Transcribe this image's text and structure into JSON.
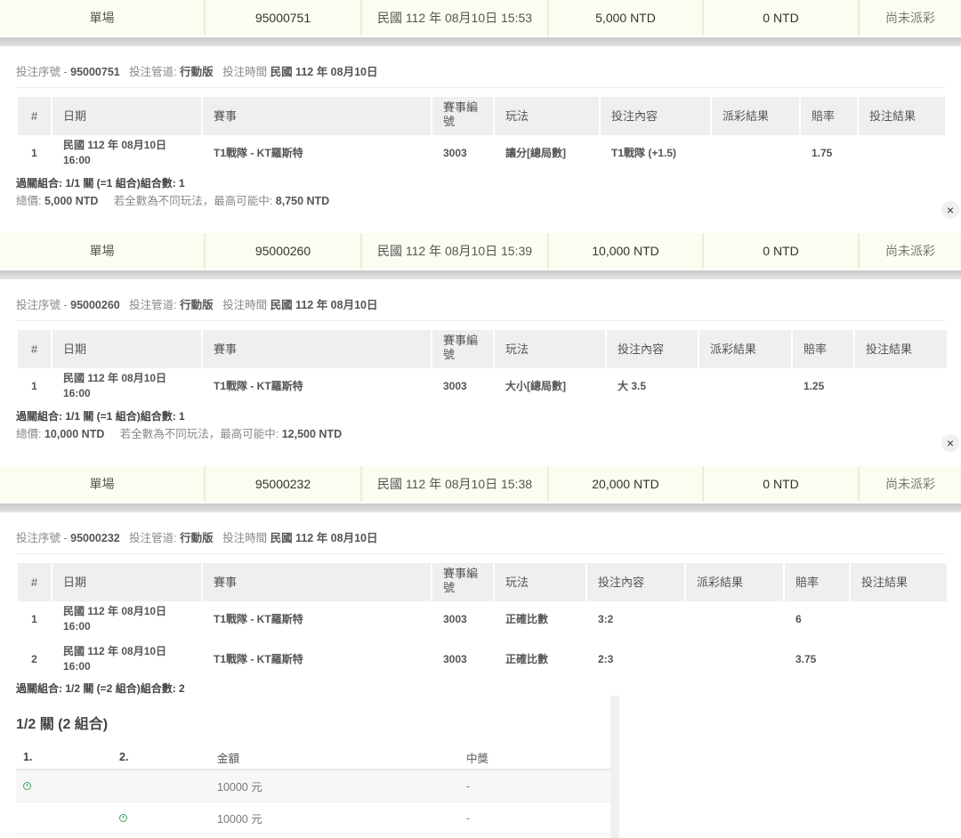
{
  "bets": [
    {
      "summary": {
        "type": "單場",
        "id": "95000751",
        "time": "民國 112 年 08月10日 15:53",
        "stake": "5,000 NTD",
        "payout": "0 NTD",
        "status": "尚未派彩"
      },
      "detail": {
        "serial_label": "投注序號 -",
        "serial": "95000751",
        "channel_label": "投注管道:",
        "channel": "行動版",
        "time_label": "投注時間",
        "time": "民國 112 年 08月10日",
        "headers": [
          "#",
          "日期",
          "賽事",
          "賽事編號",
          "玩法",
          "投注內容",
          "派彩結果",
          "賠率",
          "投注結果"
        ],
        "rows": [
          {
            "no": "1",
            "date": "民國 112 年 08月10日 16:00",
            "match": "T1戰隊 - KT羅斯特",
            "code": "3003",
            "play": "讓分[總局數]",
            "content": "T1戰隊 (+1.5)",
            "payout": "",
            "odds": "1.75",
            "result": ""
          }
        ],
        "combo": "過關組合: 1/1 關 (=1 組合)組合數: 1",
        "total_label": "總價:",
        "total": "5,000 NTD",
        "max_label": "若全數為不同玩法，最高可能中:",
        "max": "8,750 NTD",
        "close": "×"
      }
    },
    {
      "summary": {
        "type": "單場",
        "id": "95000260",
        "time": "民國 112 年 08月10日 15:39",
        "stake": "10,000 NTD",
        "payout": "0 NTD",
        "status": "尚未派彩"
      },
      "detail": {
        "serial_label": "投注序號 -",
        "serial": "95000260",
        "channel_label": "投注管道:",
        "channel": "行動版",
        "time_label": "投注時間",
        "time": "民國 112 年 08月10日",
        "headers": [
          "#",
          "日期",
          "賽事",
          "賽事編號",
          "玩法",
          "投注內容",
          "派彩結果",
          "賠率",
          "投注結果"
        ],
        "rows": [
          {
            "no": "1",
            "date": "民國 112 年 08月10日 16:00",
            "match": "T1戰隊 - KT羅斯特",
            "code": "3003",
            "play": "大小[總局數]",
            "content": "大 3.5",
            "payout": "",
            "odds": "1.25",
            "result": ""
          }
        ],
        "combo": "過關組合: 1/1 關 (=1 組合)組合數: 1",
        "total_label": "總價:",
        "total": "10,000 NTD",
        "max_label": "若全數為不同玩法，最高可能中:",
        "max": "12,500 NTD",
        "close": "×"
      }
    },
    {
      "summary": {
        "type": "單場",
        "id": "95000232",
        "time": "民國 112 年 08月10日 15:38",
        "stake": "20,000 NTD",
        "payout": "0 NTD",
        "status": "尚未派彩"
      },
      "detail": {
        "serial_label": "投注序號 -",
        "serial": "95000232",
        "channel_label": "投注管道:",
        "channel": "行動版",
        "time_label": "投注時間",
        "time": "民國 112 年 08月10日",
        "headers": [
          "#",
          "日期",
          "賽事",
          "賽事編號",
          "玩法",
          "投注內容",
          "派彩結果",
          "賠率",
          "投注結果"
        ],
        "rows": [
          {
            "no": "1",
            "date": "民國 112 年 08月10日 16:00",
            "match": "T1戰隊 - KT羅斯特",
            "code": "3003",
            "play": "正確比數",
            "content": "3:2",
            "payout": "",
            "odds": "6",
            "result": ""
          },
          {
            "no": "2",
            "date": "民國 112 年 08月10日 16:00",
            "match": "T1戰隊 - KT羅斯特",
            "code": "3003",
            "play": "正確比數",
            "content": "2:3",
            "payout": "",
            "odds": "3.75",
            "result": ""
          }
        ],
        "combo": "過關組合: 1/2 關 (=2 組合)組合數: 2",
        "combinations": {
          "title": "1/2 關 (2 組合)",
          "headers": [
            "1.",
            "2.",
            "金額",
            "中獎"
          ],
          "rows": [
            {
              "leg1": "clock-icon",
              "leg2": "",
              "amount": "10000 元",
              "win": "-"
            },
            {
              "leg1": "",
              "leg2": "clock-icon",
              "amount": "10000 元",
              "win": "-"
            }
          ]
        }
      }
    }
  ]
}
